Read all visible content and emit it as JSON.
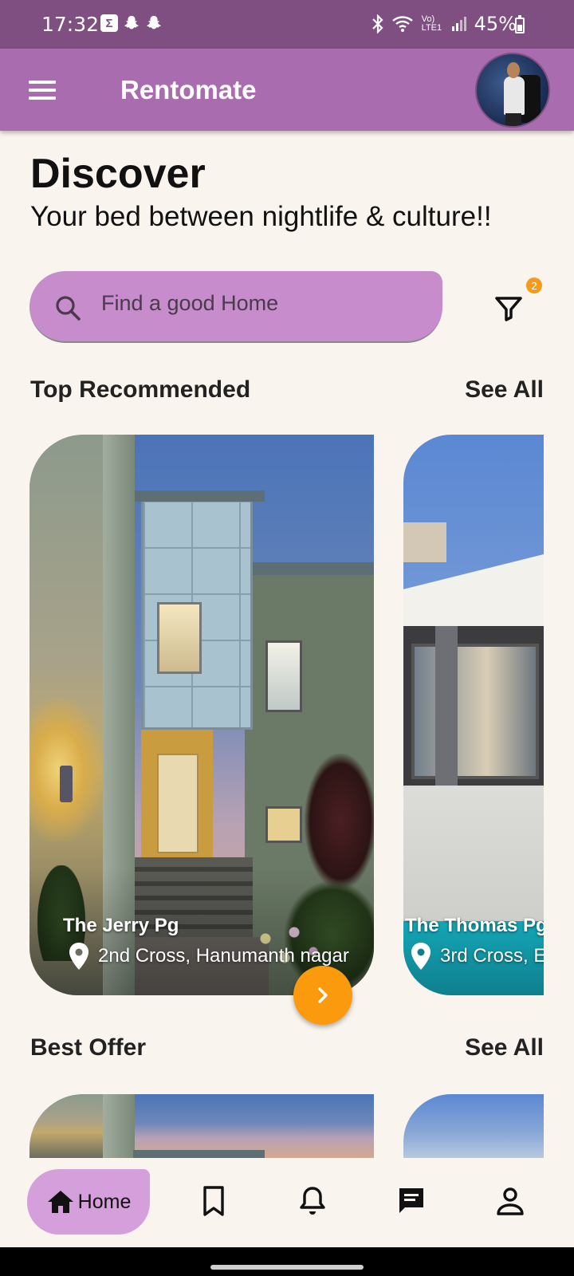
{
  "status_bar": {
    "time": "17:32",
    "signal_label": "Vo) LTE1",
    "battery": "45%"
  },
  "app_bar": {
    "title": "Rentomate"
  },
  "header": {
    "title": "Discover",
    "tagline": "Your bed between nightlife & culture!!"
  },
  "search": {
    "placeholder": "Find a good Home",
    "filter_badge": "2"
  },
  "sections": {
    "top_recommended": {
      "title": "Top Recommended",
      "see_all": "See All"
    },
    "best_offer": {
      "title": "Best Offer",
      "see_all": "See All"
    }
  },
  "cards": [
    {
      "name": "The Jerry Pg",
      "address": "2nd Cross, Hanumanth nagar"
    },
    {
      "name": "The Thomas Pg",
      "address": "3rd Cross, E"
    }
  ],
  "bottom_nav": {
    "items": [
      {
        "label": "Home",
        "icon": "home-icon"
      },
      {
        "label": "",
        "icon": "bookmark-icon"
      },
      {
        "label": "",
        "icon": "bell-icon"
      },
      {
        "label": "",
        "icon": "chat-icon"
      },
      {
        "label": "",
        "icon": "person-icon"
      }
    ]
  },
  "colors": {
    "status_bar": "#7e4f80",
    "app_bar": "#a86caf",
    "search_bg": "#c68ccb",
    "accent_orange": "#fc9a0d",
    "nav_active": "#d59fdc",
    "background": "#faf4ee"
  }
}
